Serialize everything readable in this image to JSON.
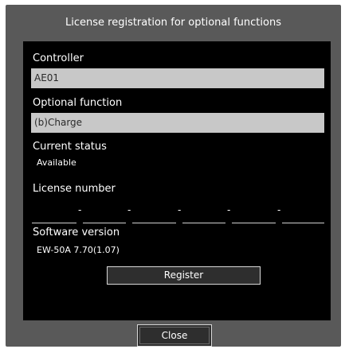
{
  "dialog": {
    "title": "License registration for optional functions"
  },
  "controller": {
    "label": "Controller",
    "value": "AE01"
  },
  "optional_function": {
    "label": "Optional function",
    "value": "(b)Charge"
  },
  "current_status": {
    "label": "Current status",
    "value": "Available"
  },
  "license_number": {
    "label": "License number",
    "fields": [
      "",
      "",
      "",
      "",
      "",
      ""
    ],
    "separator": "-"
  },
  "software_version": {
    "label": "Software version",
    "value": "EW-50A 7.70(1.07)"
  },
  "buttons": {
    "register": "Register",
    "close": "Close"
  }
}
